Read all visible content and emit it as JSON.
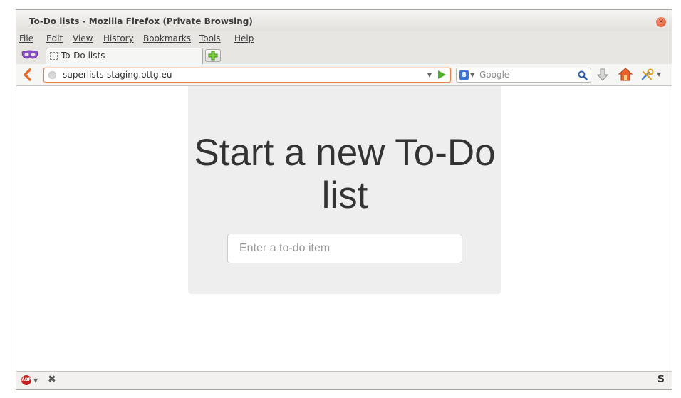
{
  "window": {
    "title": "To-Do lists - Mozilla Firefox (Private Browsing)",
    "close_icon": "×"
  },
  "menu": {
    "file": "File",
    "edit": "Edit",
    "view": "View",
    "history": "History",
    "bookmarks": "Bookmarks",
    "tools": "Tools",
    "help": "Help"
  },
  "tabs": [
    {
      "label": "To-Do lists",
      "active": true
    }
  ],
  "navbar": {
    "url": "superlists-staging.ottg.eu",
    "search_placeholder": "Google",
    "search_engine_glyph": "8"
  },
  "page": {
    "heading": "Start a new To-Do list",
    "input_placeholder": "Enter a to-do item"
  },
  "statusbar": {
    "adblock_glyph": "ABP",
    "close_glyph": "✖",
    "right_glyph": "S"
  },
  "colors": {
    "jumbotron_bg": "#eeeeee",
    "urlbar_focus": "#e1844c",
    "go_arrow": "#4caf28",
    "back_arrow": "#e36b2c",
    "close_button": "#e0532a"
  }
}
